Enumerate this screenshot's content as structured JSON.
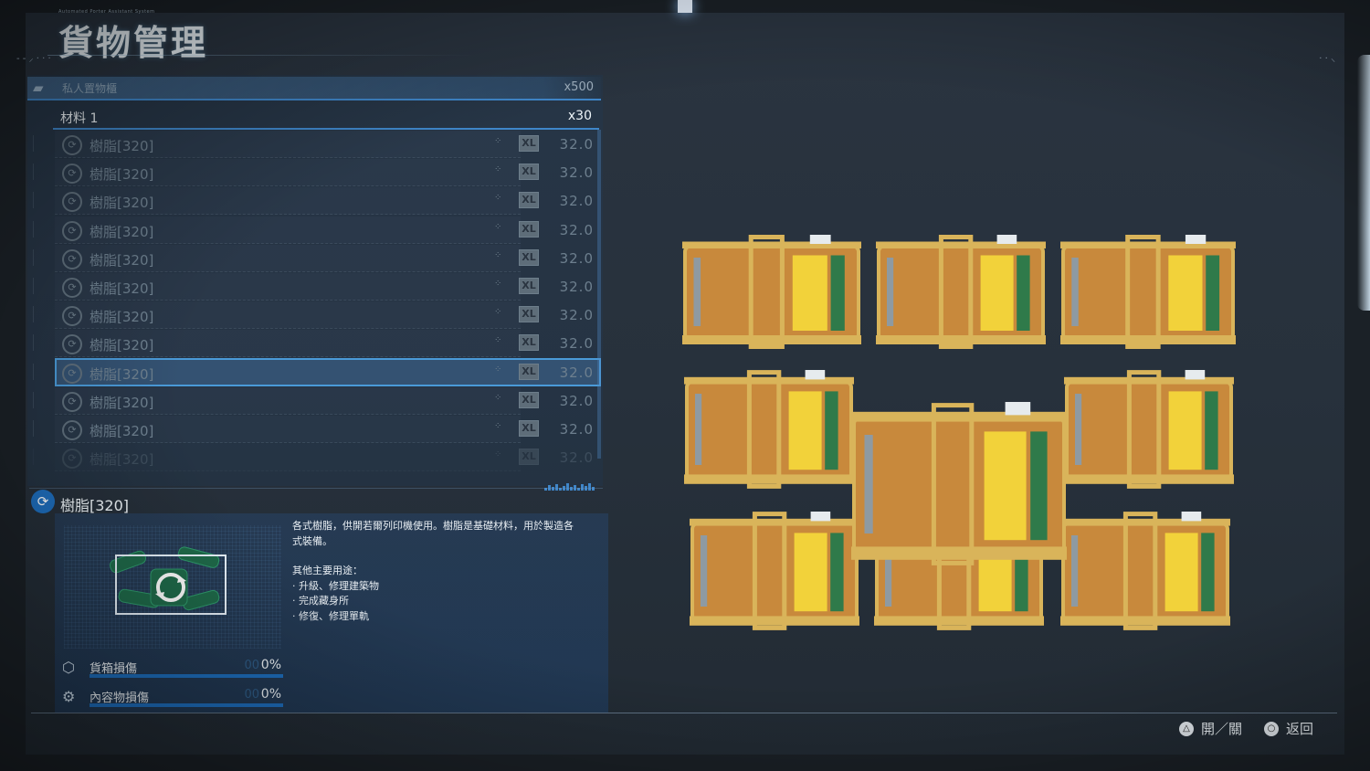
{
  "header": {
    "caption": "Automated Porter Assistant System",
    "title": "貨物管理"
  },
  "locker": {
    "icon": "locker-icon",
    "label": "私人置物櫃",
    "count": "x500"
  },
  "category": {
    "label": "材料 1",
    "count": "x30"
  },
  "items": [
    {
      "icon": "resin-icon",
      "name": "樹脂[320]",
      "size": "XL",
      "weight": "32.0"
    },
    {
      "icon": "resin-icon",
      "name": "樹脂[320]",
      "size": "XL",
      "weight": "32.0"
    },
    {
      "icon": "resin-icon",
      "name": "樹脂[320]",
      "size": "XL",
      "weight": "32.0"
    },
    {
      "icon": "resin-icon",
      "name": "樹脂[320]",
      "size": "XL",
      "weight": "32.0"
    },
    {
      "icon": "resin-icon",
      "name": "樹脂[320]",
      "size": "XL",
      "weight": "32.0"
    },
    {
      "icon": "resin-icon",
      "name": "樹脂[320]",
      "size": "XL",
      "weight": "32.0"
    },
    {
      "icon": "resin-icon",
      "name": "樹脂[320]",
      "size": "XL",
      "weight": "32.0"
    },
    {
      "icon": "resin-icon",
      "name": "樹脂[320]",
      "size": "XL",
      "weight": "32.0"
    },
    {
      "icon": "resin-icon",
      "name": "樹脂[320]",
      "size": "XL",
      "weight": "32.0",
      "selected": true
    },
    {
      "icon": "resin-icon",
      "name": "樹脂[320]",
      "size": "XL",
      "weight": "32.0"
    },
    {
      "icon": "resin-icon",
      "name": "樹脂[320]",
      "size": "XL",
      "weight": "32.0"
    },
    {
      "icon": "resin-icon",
      "name": "樹脂[320]",
      "size": "XL",
      "weight": "32.0"
    }
  ],
  "detail": {
    "name": "樹脂[320]",
    "description": [
      "各式樹脂，供開若爾列印機使用。樹脂是基礎材料，用於製造各",
      "式裝備。",
      "",
      "其他主要用途：",
      "· 升級、修理建築物",
      "· 完成藏身所",
      "· 修復、修理單軌"
    ],
    "stats": [
      {
        "icon": "box-icon",
        "label": "貨箱損傷",
        "ghost": "00",
        "value": "0%",
        "fraction": 0
      },
      {
        "icon": "gear-icon",
        "label": "內容物損傷",
        "ghost": "00",
        "value": "0%",
        "fraction": 0
      }
    ]
  },
  "controls": [
    {
      "icon": "triangle-button-icon",
      "glyph": "△",
      "label": "開／關"
    },
    {
      "icon": "circle-button-icon",
      "glyph": "○",
      "label": "返回"
    }
  ],
  "colors": {
    "accent": "#3f86c9",
    "crate_orange": "#c8893c",
    "crate_yellow": "#f2d23a",
    "crate_frame": "#d9b45a"
  }
}
